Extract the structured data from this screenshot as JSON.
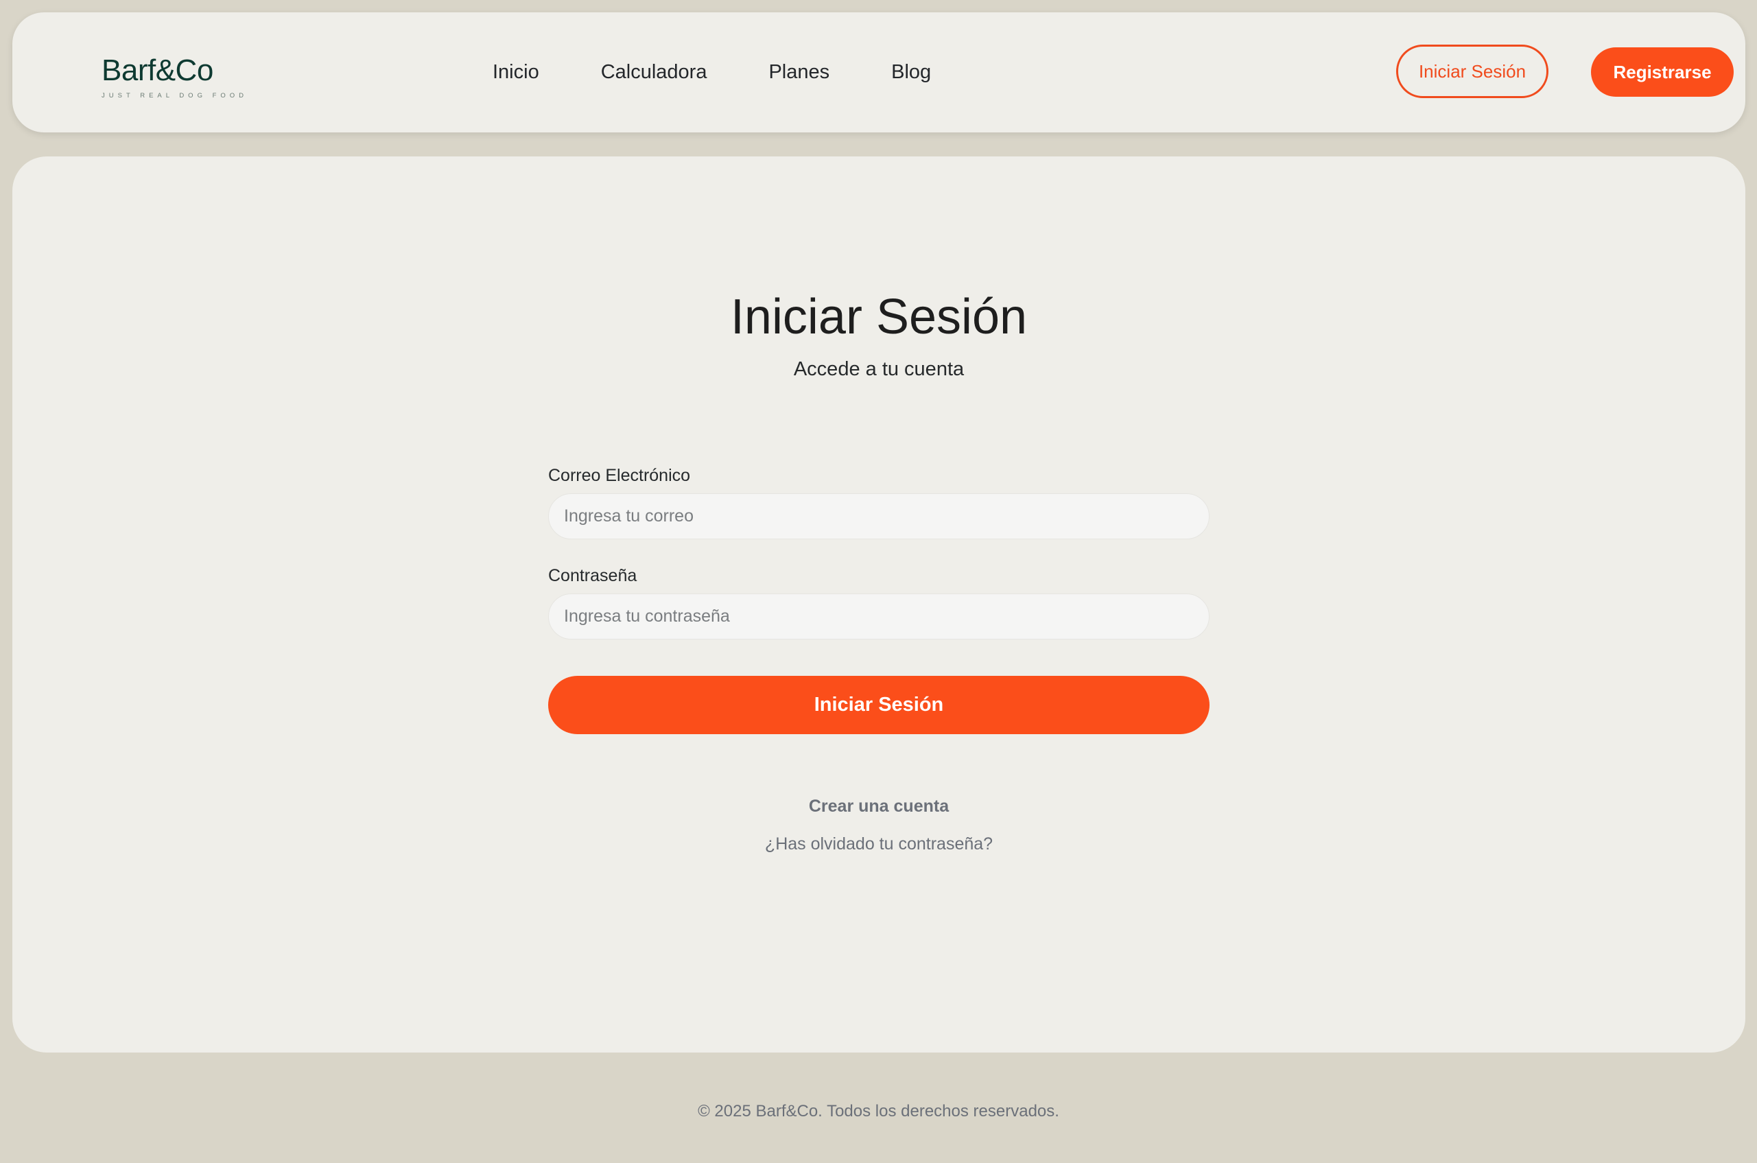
{
  "brand": {
    "name": "Barf&Co",
    "tagline": "JUST REAL DOG FOOD"
  },
  "nav": {
    "items": [
      {
        "label": "Inicio"
      },
      {
        "label": "Calculadora"
      },
      {
        "label": "Planes"
      },
      {
        "label": "Blog"
      }
    ]
  },
  "header_actions": {
    "login_label": "Iniciar Sesión",
    "register_label": "Registrarse"
  },
  "login": {
    "title": "Iniciar Sesión",
    "subtitle": "Accede a tu cuenta",
    "email": {
      "label": "Correo Electrónico",
      "placeholder": "Ingresa tu correo",
      "value": ""
    },
    "password": {
      "label": "Contraseña",
      "placeholder": "Ingresa tu contraseña",
      "value": ""
    },
    "submit_label": "Iniciar Sesión",
    "create_account_label": "Crear una cuenta",
    "forgot_password_label": "¿Has olvidado tu contraseña?"
  },
  "footer": {
    "copyright": "© 2025 Barf&Co. Todos los derechos reservados."
  },
  "colors": {
    "accent": "#fb4e1a",
    "brand_dark": "#0e3a31",
    "page_background": "#d9d5c8",
    "panel_background": "#efeee9"
  }
}
